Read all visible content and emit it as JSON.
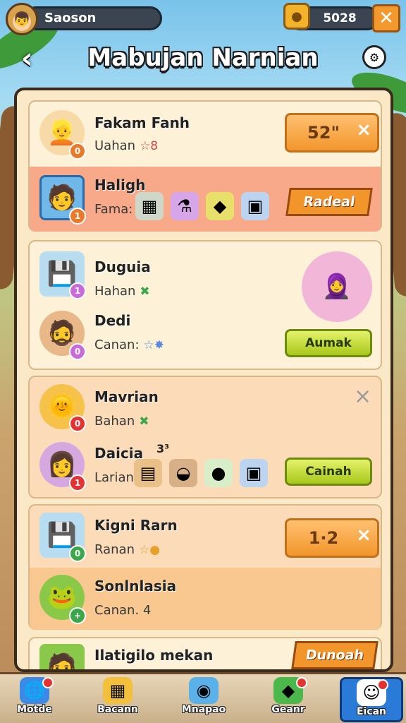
{
  "header": {
    "player_name": "Saoson",
    "coins": "5028",
    "title": "Mabujan Narnian"
  },
  "rows": [
    {
      "name": "Fakam Fanh",
      "sub": "Uahan",
      "sub_icon": "☆8",
      "value": "52\"",
      "badge": "0"
    },
    {
      "name": "Haligh",
      "sub": "Fama:",
      "action": "Radeal",
      "badge": "1"
    },
    {
      "name": "Duguia",
      "sub": "Hahan",
      "sub_icon": "✖",
      "badge": "1"
    },
    {
      "name": "Dedi",
      "sub": "Canan:",
      "sub_icon": "☆✸",
      "action": "Aumak",
      "badge": "0"
    },
    {
      "name": "Mavrian",
      "sub": "Bahan",
      "sub_icon": "✖",
      "badge": "0"
    },
    {
      "name": "Daicia",
      "sub": "Larian",
      "action": "Cainah",
      "badge": "1",
      "note": "3³"
    },
    {
      "name": "Kigni Rarn",
      "sub": "Ranan",
      "sub_icon": "☆●",
      "value": "1·2",
      "badge": "0"
    },
    {
      "name": "Sonlnlasia",
      "sub": "Canan. 4",
      "badge": "+"
    },
    {
      "name": "Ilatigilo mekan",
      "action": "Dunoah"
    }
  ],
  "nav": [
    {
      "label": "Motde"
    },
    {
      "label": "Bacann"
    },
    {
      "label": "Mnapao"
    },
    {
      "label": "Geanr"
    },
    {
      "label": "Eican"
    }
  ],
  "colors": {
    "accent_orange": "#f2962c",
    "accent_green": "#a8c81a",
    "highlight_row": "#f7a98a",
    "panel_bg": "#fbe8c6",
    "nav_active": "#2a7ad8"
  }
}
